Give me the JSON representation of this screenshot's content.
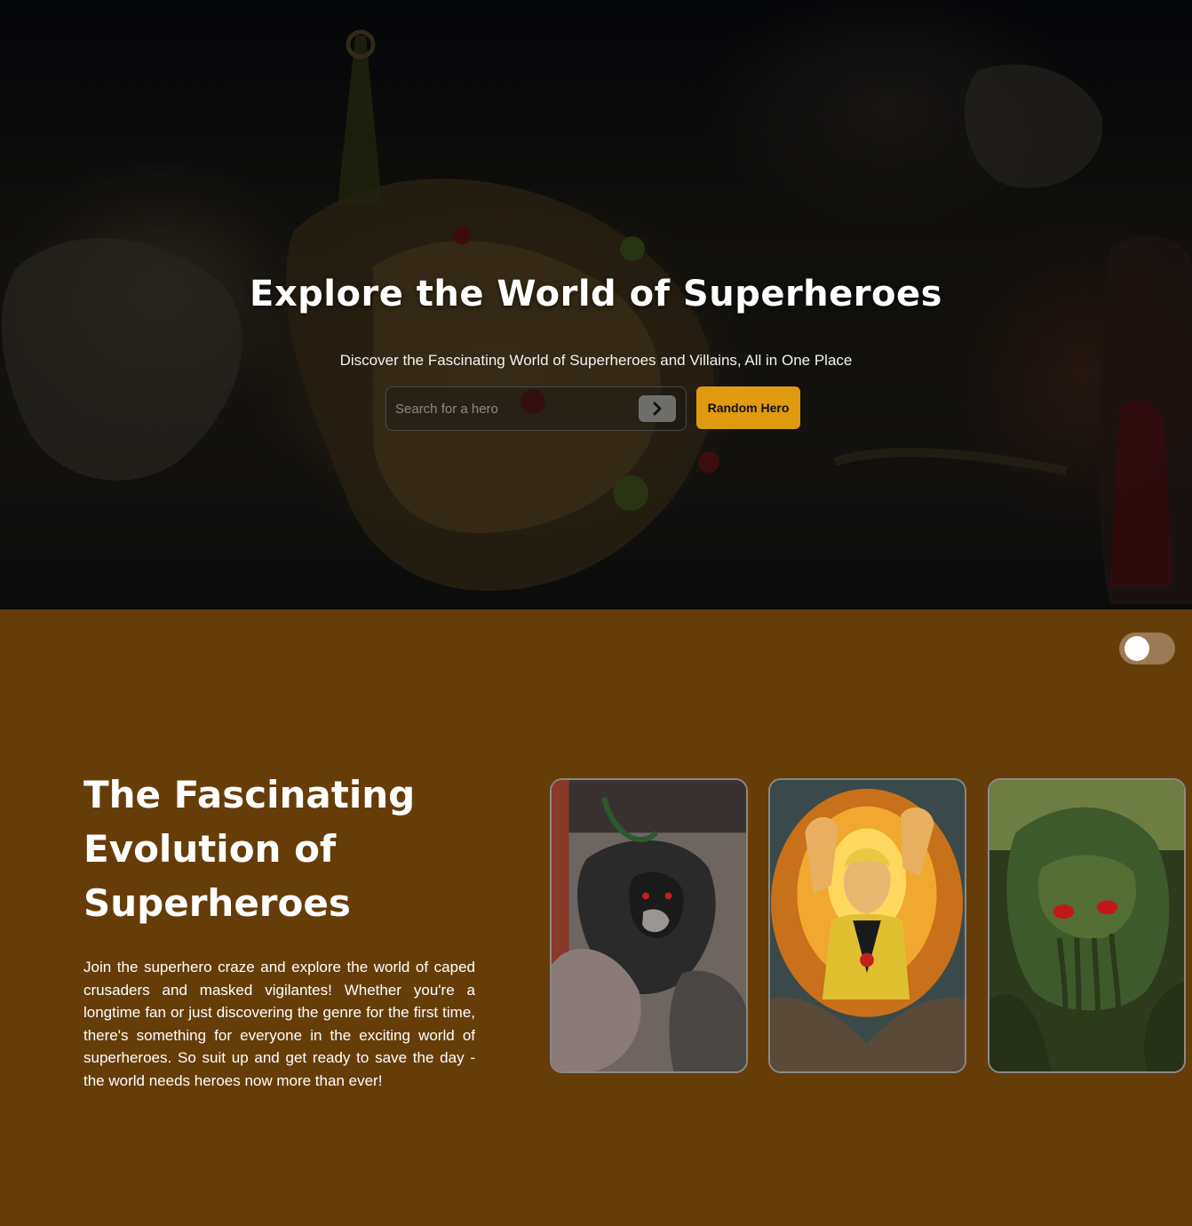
{
  "hero": {
    "title": "Explore the World of Superheroes",
    "subtitle": "Discover the Fascinating World of Superheroes and Villains, All in One Place",
    "search": {
      "placeholder": "Search for a hero",
      "value": ""
    },
    "random_button_label": "Random Hero",
    "search_icon": "chevron-right-icon"
  },
  "section": {
    "theme_toggle": {
      "state": "off"
    },
    "title": "The Fascinating Evolution of Superheroes",
    "text": "Join the superhero craze and explore the world of caped crusaders and masked vigilantes! Whether you're a longtime fan or just discovering the genre for the first time, there's something for everyone in the exciting world of superheroes. So suit up and get ready to save the day - the world needs heroes now more than ever!",
    "cards": [
      {
        "icon": "masked-villain-comic-image",
        "accent": "#7a6e66"
      },
      {
        "icon": "flaming-hero-comic-image",
        "accent": "#e08a20"
      },
      {
        "icon": "swamp-creature-comic-image",
        "accent": "#3e5a2a"
      }
    ]
  },
  "colors": {
    "section_bg": "#663d09",
    "accent": "#e09a10",
    "toggle_bg": "#9b7a56"
  }
}
